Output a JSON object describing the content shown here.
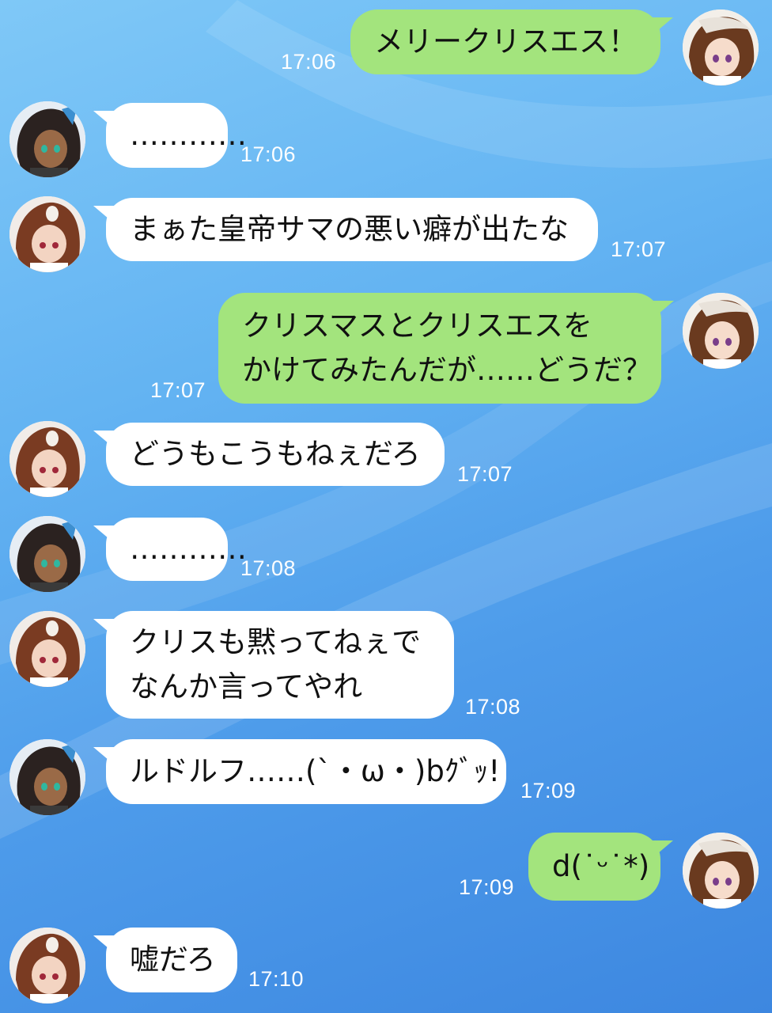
{
  "chat": {
    "messages": [
      {
        "sender": "rudolf",
        "dir": "out",
        "text": "メリークリスエス！",
        "time": "17:06"
      },
      {
        "sender": "kris",
        "dir": "in",
        "text": "…………",
        "time": "17:06"
      },
      {
        "sender": "shakur",
        "dir": "in",
        "text": "まぁた皇帝サマの悪い癖が出たな",
        "time": "17:07"
      },
      {
        "sender": "rudolf",
        "dir": "out",
        "text": "クリスマスとクリスエスを\nかけてみたんだが……どうだ？",
        "time": "17:07"
      },
      {
        "sender": "shakur",
        "dir": "in",
        "text": "どうもこうもねぇだろ",
        "time": "17:07"
      },
      {
        "sender": "kris",
        "dir": "in",
        "text": "…………",
        "time": "17:08"
      },
      {
        "sender": "shakur",
        "dir": "in",
        "text": "クリスも黙ってねぇで\nなんか言ってやれ",
        "time": "17:08"
      },
      {
        "sender": "kris",
        "dir": "in",
        "text": "ルドルフ……(`・ω・)bｸﾞｯ!",
        "time": "17:09"
      },
      {
        "sender": "rudolf",
        "dir": "out",
        "text": "d(˙ᵕ˙*)",
        "time": "17:09"
      },
      {
        "sender": "shakur",
        "dir": "in",
        "text": "嘘だろ",
        "time": "17:10"
      }
    ]
  },
  "colors": {
    "outgoing_bubble": "#a3e47d",
    "incoming_bubble": "#ffffff",
    "timestamp": "#ffffff"
  },
  "icons": {
    "rudolf": "avatar-brown-white-streak-icon",
    "kris": "avatar-dark-hair-icon",
    "shakur": "avatar-brown-hair-icon"
  }
}
